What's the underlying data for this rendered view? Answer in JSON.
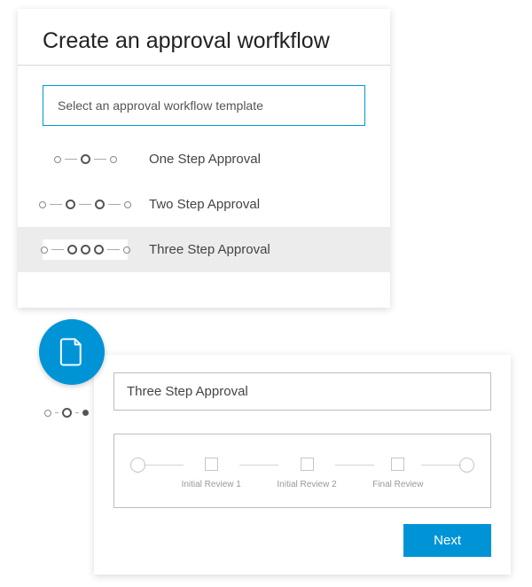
{
  "header": {
    "title": "Create an approval worfkflow"
  },
  "select": {
    "placeholder": "Select an approval workflow template"
  },
  "options": [
    {
      "label": "One Step Approval"
    },
    {
      "label": "Two Step Approval"
    },
    {
      "label": "Three Step Approval"
    }
  ],
  "details": {
    "title_value": "Three Step Approval",
    "steps": [
      {
        "label": "Initial Review 1"
      },
      {
        "label": "Initial Review 2"
      },
      {
        "label": "Final Review"
      }
    ],
    "next_label": "Next"
  },
  "colors": {
    "accent": "#0094d6"
  }
}
